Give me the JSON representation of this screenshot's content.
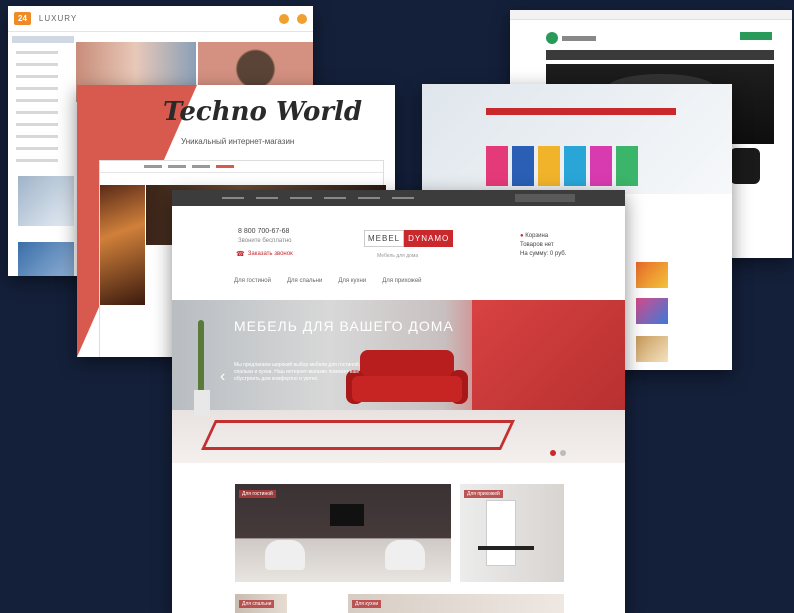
{
  "techno": {
    "title": "Techno World",
    "subtitle": "Уникальный интернет-магазин"
  },
  "front": {
    "phone": "8 800 700-67-68",
    "phone_sub": "Звоните бесплатно",
    "callback": "Заказать звонок",
    "logo_a": "MEBEL",
    "logo_b": "DYNAMO",
    "logo_sub": "Мебель для дома",
    "right_info_1": "Корзина",
    "right_info_2": "Товаров нет",
    "right_info_3": "На сумму: 0 руб.",
    "menu": [
      "Для гостиной",
      "Для спальни",
      "Для кухни",
      "Для прихожей"
    ],
    "hero_title": "МЕБЕЛЬ ДЛЯ ВАШЕГО ДОМА",
    "hero_desc": "Мы предлагаем широкий выбор мебели для гостиной, спальни и кухни. Наш интернет-магазин поможет вам обустроить дом комфортно и уютно.",
    "arrow_glyph": "‹",
    "tile_1_label": "Для гостиной",
    "tile_2_label": "Для прихожей",
    "tile_3_label": "Для спальни",
    "tile_4_label": "Для кухни"
  },
  "colors": {
    "background": "#14203a",
    "accent_red": "#c9282d",
    "brand_green": "#2a9a5a",
    "shop_orange": "#f08a24"
  },
  "icons": {
    "callback": "phone-icon",
    "hero_prev": "chevron-left-icon"
  }
}
